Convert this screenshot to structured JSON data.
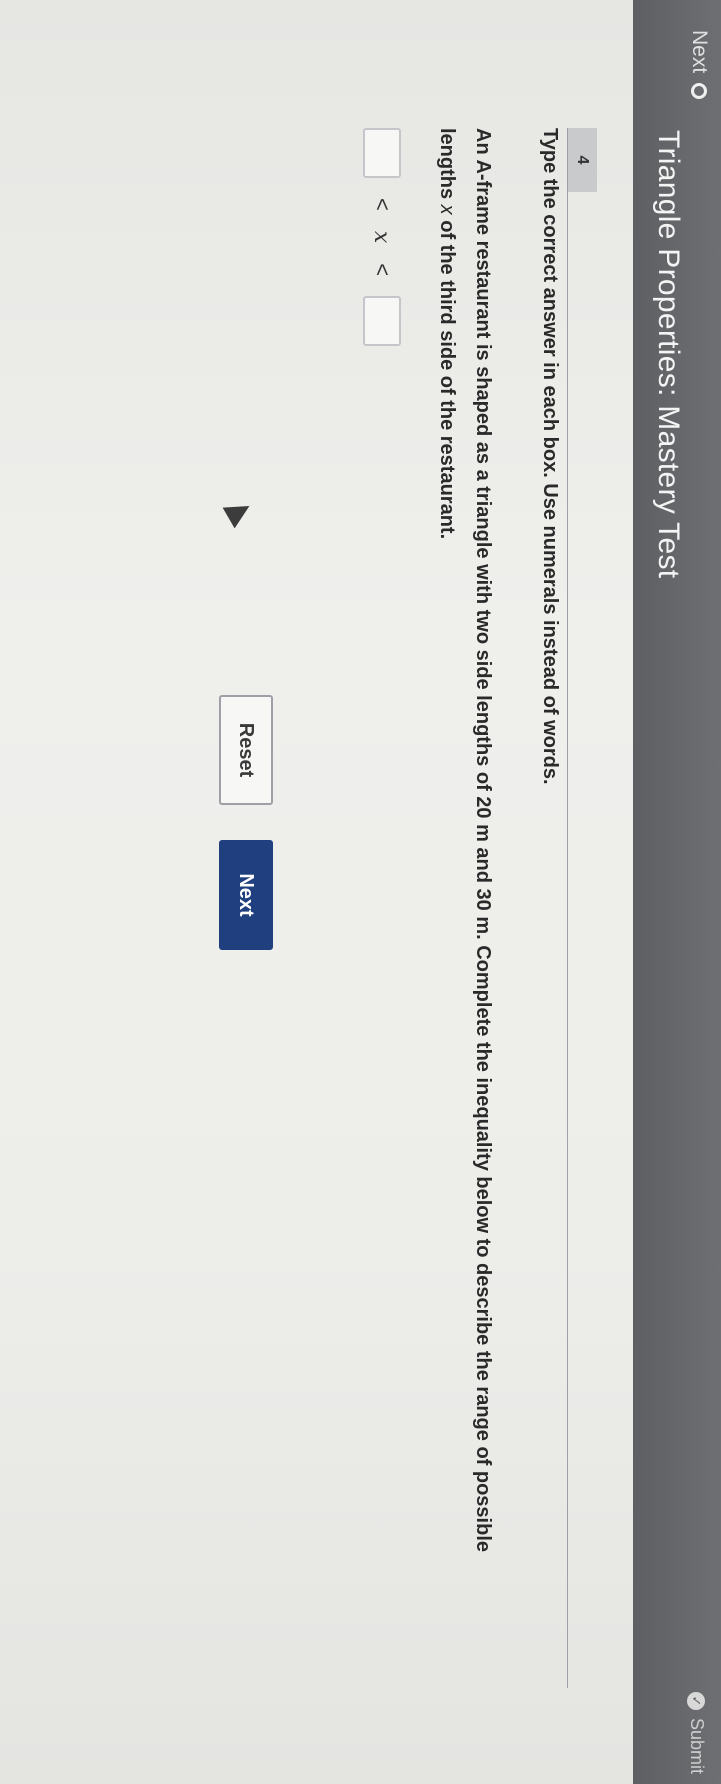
{
  "header": {
    "next_label": "Next",
    "title": "Triangle Properties: Mastery Test",
    "submit_label": "Submit"
  },
  "question": {
    "number": "4",
    "instruction": "Type the correct answer in each box. Use numerals instead of words.",
    "prompt_line1_a": "An A-frame restaurant is shaped as a triangle with two side lengths of 20 m and 30 m. Complete the inequality below to describe the range of possible",
    "prompt_line2_a": "lengths ",
    "prompt_var": "x",
    "prompt_line2_b": " of the third side of the restaurant.",
    "inequality": {
      "left_value": "",
      "less_than_1": "<",
      "variable": "x",
      "less_than_2": "<",
      "right_value": ""
    }
  },
  "buttons": {
    "reset_label": "Reset",
    "next_label": "Next"
  }
}
